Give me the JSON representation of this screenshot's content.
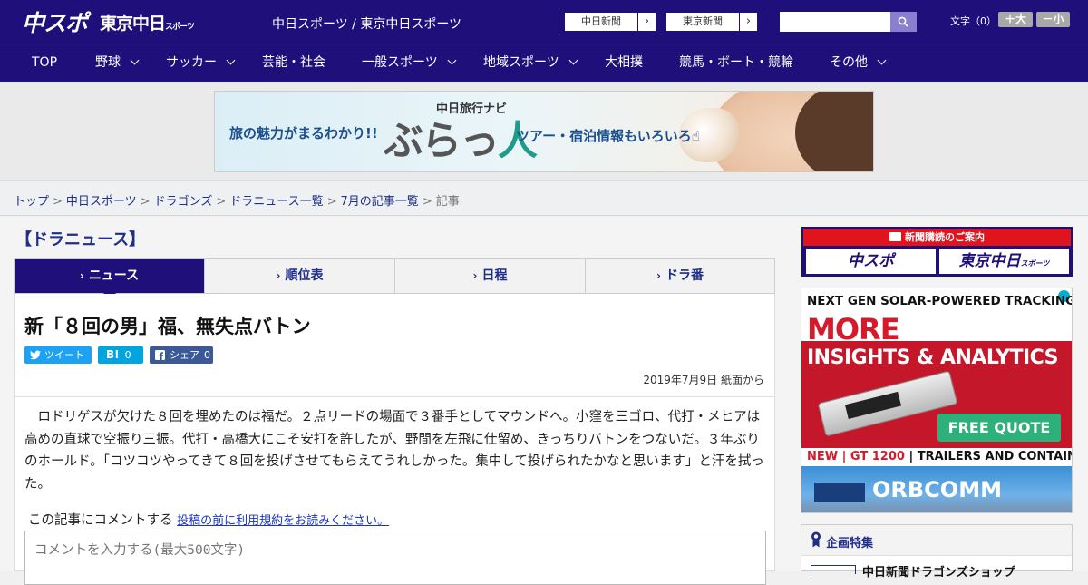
{
  "header": {
    "logo_chunichi_sports": "中スポ",
    "logo_tokyo_chunichi": "東京中日",
    "logo_tokyo_chunichi_small": "スポーツ",
    "site_name": "中日スポーツ / 東京中日スポーツ",
    "paper_links": [
      {
        "label": "中日新聞"
      },
      {
        "label": "東京新聞"
      }
    ],
    "search_placeholder": "",
    "font_size_label": "文字（0）",
    "font_bigger": "＋大",
    "font_smaller": "－小",
    "arrow_glyph": "›"
  },
  "nav": {
    "items": [
      {
        "label": "TOP",
        "has_dropdown": false
      },
      {
        "label": "野球",
        "has_dropdown": true
      },
      {
        "label": "サッカー",
        "has_dropdown": true
      },
      {
        "label": "芸能・社会",
        "has_dropdown": false
      },
      {
        "label": "一般スポーツ",
        "has_dropdown": true
      },
      {
        "label": "地域スポーツ",
        "has_dropdown": true
      },
      {
        "label": "大相撲",
        "has_dropdown": false
      },
      {
        "label": "競馬・ボート・競輪",
        "has_dropdown": false
      },
      {
        "label": "その他",
        "has_dropdown": true
      }
    ]
  },
  "banner": {
    "left_text": "旅の魅力がまるわかり!!",
    "navi_label": "中日旅行ナビ",
    "logo_text_a": "ぶらっ",
    "logo_text_b": "人",
    "right_text": "ツアー・宿泊情報もいろいろ☝"
  },
  "breadcrumb": {
    "links": [
      "トップ",
      "中日スポーツ",
      "ドラゴンズ",
      "ドラニュース一覧",
      "7月の記事一覧"
    ],
    "current": "記事",
    "separator": ">"
  },
  "section_title": "【ドラニュース】",
  "tabs": [
    {
      "label": "ニュース",
      "active": true
    },
    {
      "label": "順位表",
      "active": false
    },
    {
      "label": "日程",
      "active": false
    },
    {
      "label": "ドラ番",
      "active": false
    }
  ],
  "article": {
    "headline": "新「８回の男」福、無失点バトン",
    "share": {
      "tweet_label": "ツイート",
      "hatena_label": "B!",
      "hatena_count": "0",
      "facebook_label": "シェア",
      "facebook_count": "0"
    },
    "date": "2019年7月9日 紙面から",
    "body": "ロドリゲスが欠けた８回を埋めたのは福だ。２点リードの場面で３番手としてマウンドへ。小窪を三ゴロ、代打・メヒアは高めの直球で空振り三振。代打・高橋大にこそ安打を許したが、野間を左飛に仕留め、きっちりバトンをつないだ。３年ぶりのホールド。「コツコツやってきて８回を投げさせてもらえてうれしかった。集中して投げられたかなと思います」と汗を拭った。",
    "comment_label": "この記事にコメントする",
    "comment_terms_link": "投稿の前に利用規約をお読みください。",
    "comment_placeholder": "コメントを入力する(最大500文字)"
  },
  "sidebar": {
    "subscribe_header": "新聞購読のご案内",
    "subscribe_logo_1": "中スポ",
    "subscribe_logo_2": "東京中日",
    "subscribe_logo_2_small": "スポーツ",
    "ad": {
      "line1": "NEXT GEN SOLAR-POWERED TRACKING",
      "line2": "MORE",
      "line3": "INSIGHTS & ANALYTICS",
      "cta": "FREE QUOTE",
      "line4_new": "NEW | GT 1200",
      "line4_rest": " | TRAILERS AND CONTAINERS",
      "brand": "ORBCOMM",
      "adchoices_glyph": "i"
    },
    "feature_header": "企画特集",
    "feature_item": "中日新聞ドラゴンズショップ"
  },
  "colors": {
    "brand_navy": "#1f0f7a",
    "link_blue": "#1f2e87",
    "twitter": "#1da1f2",
    "hatena": "#00a4de",
    "facebook": "#3b5998",
    "subscribe_red": "#e0141c"
  }
}
